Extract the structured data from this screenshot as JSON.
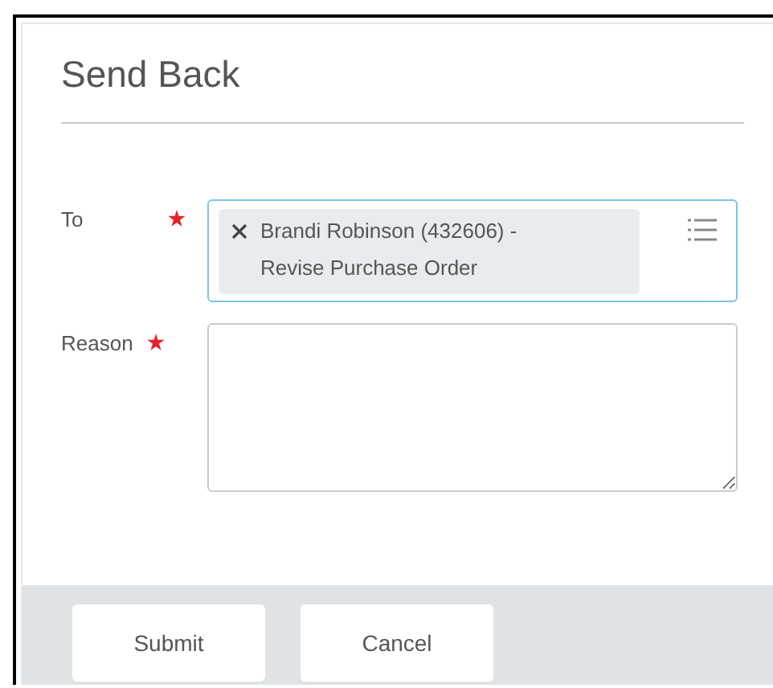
{
  "dialog": {
    "title": "Send Back"
  },
  "fields": [
    {
      "kind": "chips",
      "label": "To",
      "required": true,
      "chips": [
        "Brandi Robinson (432606) - Revise Purchase Order"
      ]
    },
    {
      "kind": "textarea",
      "label": "Reason",
      "required": true
    }
  ],
  "buttons": [
    "Submit",
    "Cancel"
  ]
}
